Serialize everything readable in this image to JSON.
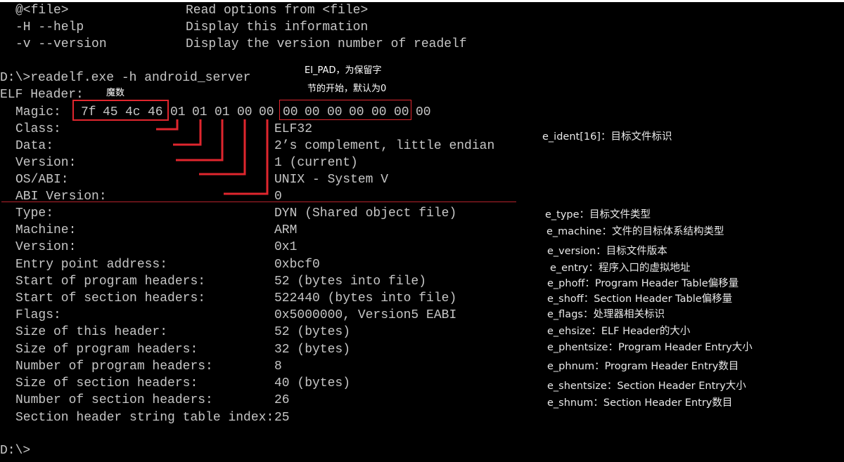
{
  "terminal": {
    "help_lines": [
      {
        "opt": "@<file>",
        "desc": "Read options from <file>"
      },
      {
        "opt": "-H --help",
        "desc": "Display this information"
      },
      {
        "opt": "-v --version",
        "desc": "Display the version number of readelf"
      }
    ],
    "command": "D:\\>readelf.exe -h android_server",
    "header_title": "ELF Header:",
    "magic_label": "Magic:",
    "magic_bytes": [
      "7f",
      "45",
      "4c",
      "46",
      "01",
      "01",
      "01",
      "00",
      "00",
      "00",
      "00",
      "00",
      "00",
      "00",
      "00",
      "00"
    ],
    "ident_fields": [
      {
        "key": "Class:",
        "value": "ELF32"
      },
      {
        "key": "Data:",
        "value": "2’s complement, little endian"
      },
      {
        "key": "Version:",
        "value": "1 (current)"
      },
      {
        "key": "OS/ABI:",
        "value": "UNIX - System V"
      },
      {
        "key": "ABI Version:",
        "value": "0"
      }
    ],
    "header_fields": [
      {
        "key": "Type:",
        "value": "DYN (Shared object file)"
      },
      {
        "key": "Machine:",
        "value": "ARM"
      },
      {
        "key": "Version:",
        "value": "0x1"
      },
      {
        "key": "Entry point address:",
        "value": "0xbcf0"
      },
      {
        "key": "Start of program headers:",
        "value": "52 (bytes into file)"
      },
      {
        "key": "Start of section headers:",
        "value": "522440 (bytes into file)"
      },
      {
        "key": "Flags:",
        "value": "0x5000000, Version5 EABI"
      },
      {
        "key": "Size of this header:",
        "value": "52 (bytes)"
      },
      {
        "key": "Size of program headers:",
        "value": "32 (bytes)"
      },
      {
        "key": "Number of program headers:",
        "value": "8"
      },
      {
        "key": "Size of section headers:",
        "value": "40 (bytes)"
      },
      {
        "key": "Number of section headers:",
        "value": "26"
      },
      {
        "key": "Section header string table index:",
        "value": "25"
      }
    ],
    "prompt": "D:\\>"
  },
  "annotations": {
    "magic": "魔数",
    "ei_pad_line1": "EI_PAD，为保留字",
    "ei_pad_line2": "节的开始，默认为0"
  },
  "field_labels": {
    "ident": "e_ident[16]：目标文件标识",
    "items": [
      "e_type：目标文件类型",
      "e_machine：文件的目标体系结构类型",
      "e_version：目标文件版本",
      "e_entry：程序入口的虚拟地址",
      "e_phoff：Program Header Table偏移量",
      "e_shoff：Section Header Table偏移量",
      "e_flags：处理器相关标识",
      "e_ehsize：ELF Header的大小",
      "e_phentsize：Program Header Entry大小",
      "e_phnum：Program Header Entry数目",
      "e_shentsize：Section Header Entry大小",
      "e_shnum：Section Header Entry数目"
    ]
  },
  "colors": {
    "background": "#000000",
    "text": "#c6c6c6",
    "accent": "#e0262e"
  }
}
